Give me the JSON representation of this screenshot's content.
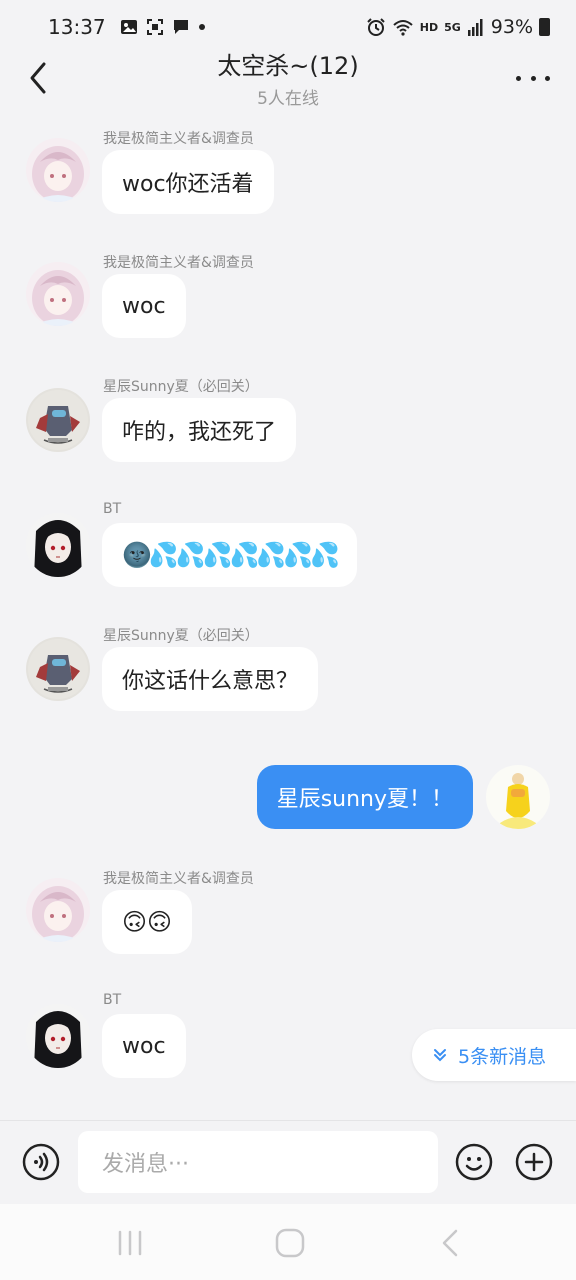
{
  "status_bar": {
    "time": "13:37",
    "network": "HD",
    "signal": "5G",
    "battery": "93%"
  },
  "header": {
    "title": "太空杀~(12)",
    "subtitle": "5人在线"
  },
  "messages": [
    {
      "sender": "我是极简主义者&调查员",
      "text": "woc你还活着",
      "avatar": "pink-hair-anime-avatar"
    },
    {
      "sender": "我是极简主义者&调查员",
      "text": "woc",
      "avatar": "pink-hair-anime-avatar"
    },
    {
      "sender": "星辰Sunny夏（必回关）",
      "text": "咋的，我还死了",
      "avatar": "among-us-sketch-avatar"
    },
    {
      "sender": "BT",
      "text": "🌚💦💦💦💦💦💦💦",
      "avatar": "dark-hair-anime-avatar"
    },
    {
      "sender": "星辰Sunny夏（必回关）",
      "text": "你这话什么意思？",
      "avatar": "among-us-sketch-avatar"
    },
    {
      "sender": "",
      "text": "星辰sunny夏！！",
      "avatar": "yellow-crewmate-avatar",
      "self": true
    },
    {
      "sender": "我是极简主义者&调查员",
      "text": "🙃🙃",
      "avatar": "pink-hair-anime-avatar"
    },
    {
      "sender": "BT",
      "text": "woc",
      "avatar": "dark-hair-anime-avatar"
    }
  ],
  "new_messages": "5条新消息",
  "input": {
    "placeholder": "发消息···"
  },
  "colors": {
    "accent": "#3a8ff3",
    "background": "#f3f3f5",
    "bubble": "#ffffff"
  }
}
